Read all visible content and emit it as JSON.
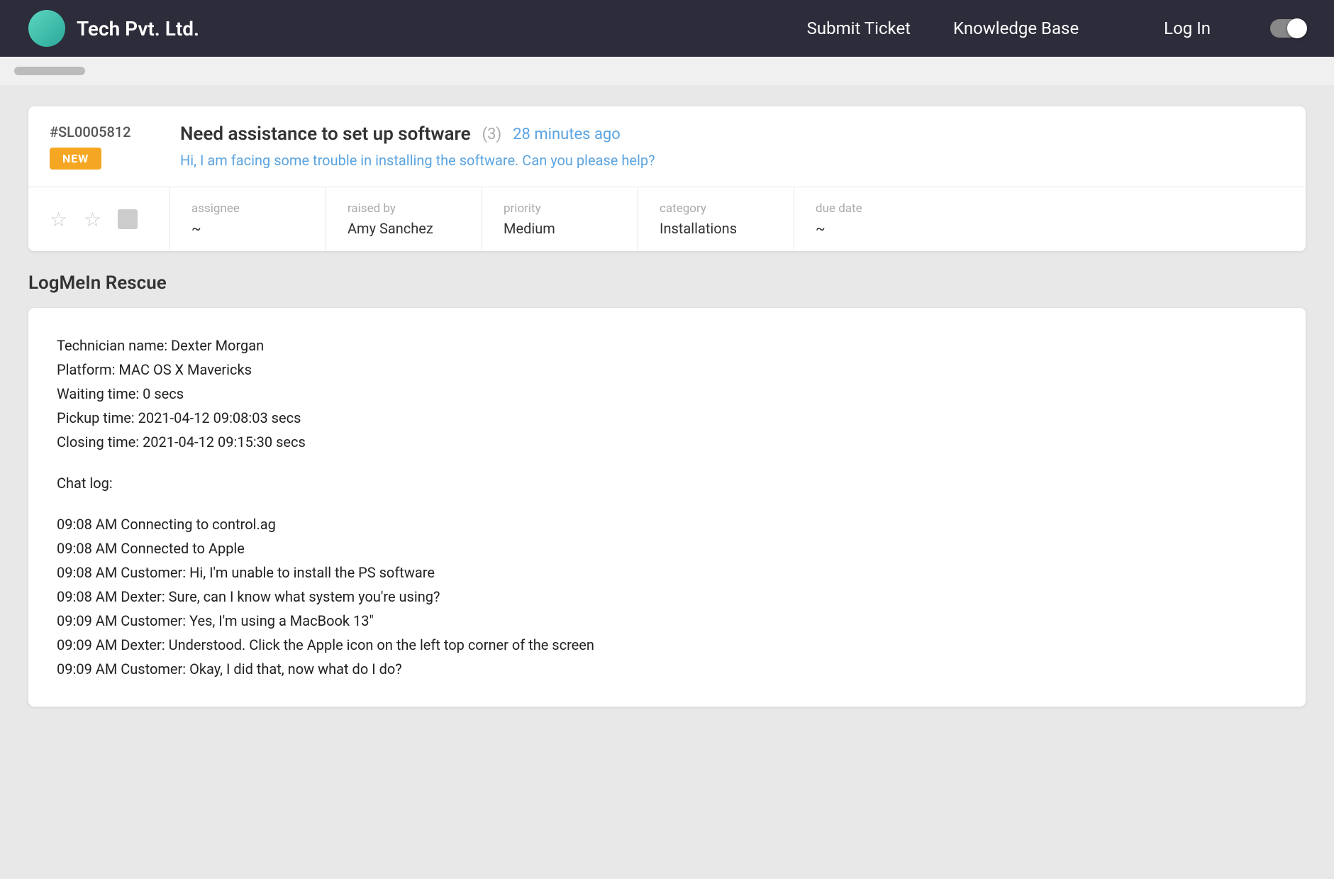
{
  "header": {
    "brand_title": "Tech Pvt. Ltd.",
    "nav": {
      "submit_ticket": "Submit Ticket",
      "knowledge_base": "Knowledge Base",
      "login": "Log In"
    }
  },
  "ticket": {
    "id": "#SL0005812",
    "badge": "NEW",
    "title": "Need assistance to set up software",
    "count": "(3)",
    "time": "28 minutes ago",
    "description": "Hi, I am facing some trouble in installing the software. Can you please help?",
    "meta": {
      "assignee_label": "assignee",
      "assignee_value": "~",
      "raised_by_label": "raised by",
      "raised_by_value": "Amy Sanchez",
      "priority_label": "priority",
      "priority_value": "Medium",
      "category_label": "category",
      "category_value": "Installations",
      "due_date_label": "due date",
      "due_date_value": "~"
    }
  },
  "logmein": {
    "section_title": "LogMeIn Rescue",
    "lines": [
      "Technician name: Dexter Morgan",
      "Platform: MAC OS X Mavericks",
      "Waiting time: 0 secs",
      "Pickup time: 2021-04-12 09:08:03 secs",
      "Closing time: 2021-04-12 09:15:30 secs"
    ],
    "chat_label": "Chat log:",
    "chat_lines": [
      "09:08 AM Connecting to control.ag",
      "09:08 AM Connected to Apple",
      "09:08 AM Customer: Hi, I'm unable to install the PS software",
      "09:08 AM Dexter: Sure, can I know what system you're using?",
      "09:09 AM Customer: Yes, I'm using a MacBook 13\"",
      "09:09 AM Dexter: Understood. Click the Apple icon on the left top corner of the screen",
      "09:09 AM Customer: Okay, I did that, now what do I do?"
    ]
  }
}
